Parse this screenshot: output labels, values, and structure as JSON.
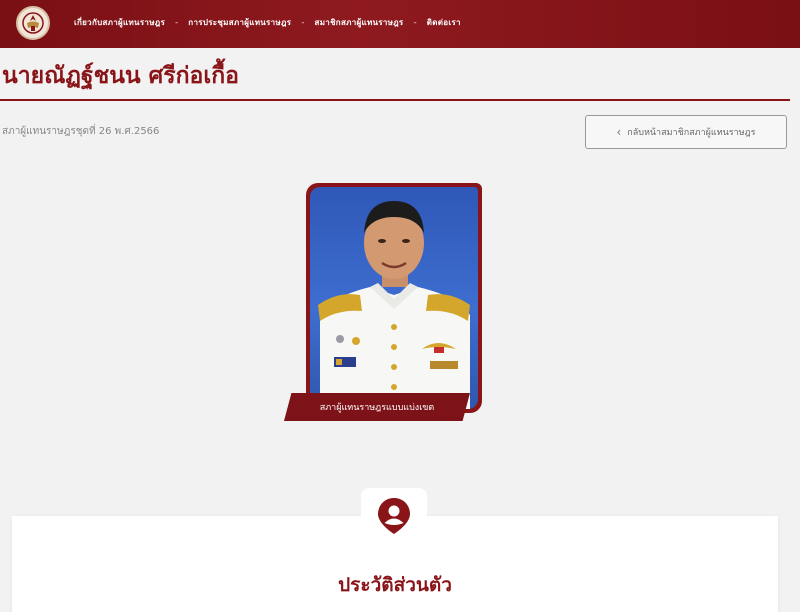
{
  "nav": {
    "items": [
      "เกี่ยวกับสภาผู้แทนราษฎร",
      "การประชุมสภาผู้แทนราษฎร",
      "สมาชิกสภาผู้แทนราษฎร",
      "ติดต่อเรา"
    ]
  },
  "page": {
    "title": "นายณัฏฐ์ชนน ศรีก่อเกื้อ",
    "subtitle": "สภาผู้แทนราษฎรชุดที่ 26 พ.ศ.2566",
    "back_label": "กลับหน้าสมาชิกสภาผู้แทนราษฎร"
  },
  "profile": {
    "banner": "สภาผู้แทนราษฎรแบบแบ่งเขต"
  },
  "section": {
    "title": "ประวัติส่วนตัว"
  },
  "colors": {
    "brand": "#8a1519",
    "nav_bg": "#7a0f14"
  },
  "icons": {
    "logo": "parliament-emblem",
    "back": "chevron-left-icon",
    "section": "map-pin-person-icon"
  }
}
